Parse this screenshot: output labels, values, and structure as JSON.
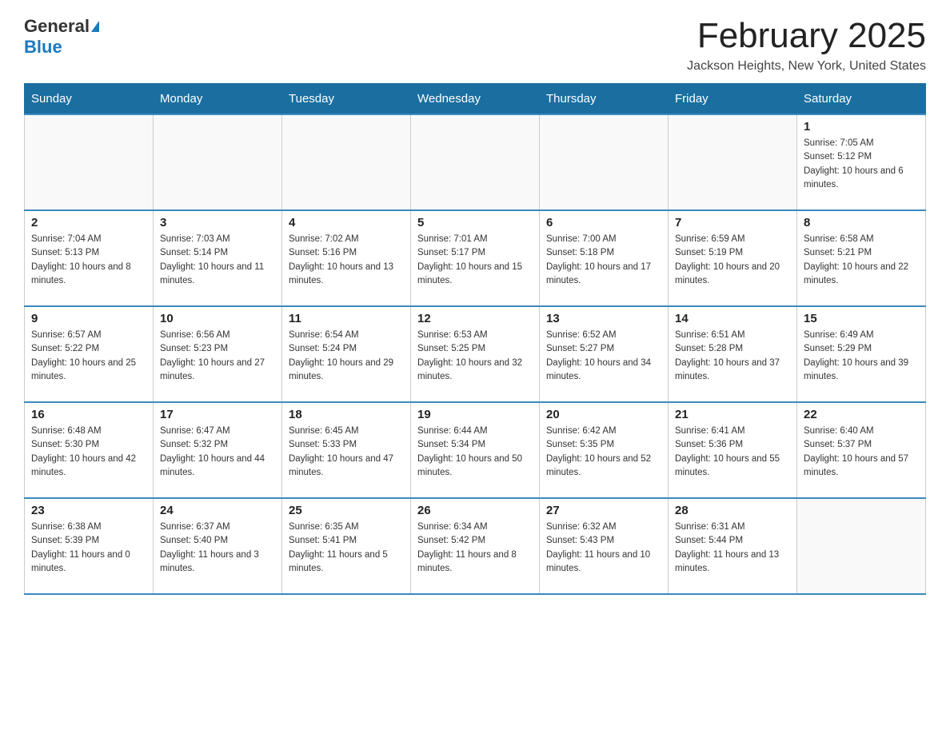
{
  "header": {
    "logo_general": "General",
    "logo_blue": "Blue",
    "month_title": "February 2025",
    "location": "Jackson Heights, New York, United States"
  },
  "days_of_week": [
    "Sunday",
    "Monday",
    "Tuesday",
    "Wednesday",
    "Thursday",
    "Friday",
    "Saturday"
  ],
  "weeks": [
    [
      {
        "day": "",
        "info": ""
      },
      {
        "day": "",
        "info": ""
      },
      {
        "day": "",
        "info": ""
      },
      {
        "day": "",
        "info": ""
      },
      {
        "day": "",
        "info": ""
      },
      {
        "day": "",
        "info": ""
      },
      {
        "day": "1",
        "info": "Sunrise: 7:05 AM\nSunset: 5:12 PM\nDaylight: 10 hours and 6 minutes."
      }
    ],
    [
      {
        "day": "2",
        "info": "Sunrise: 7:04 AM\nSunset: 5:13 PM\nDaylight: 10 hours and 8 minutes."
      },
      {
        "day": "3",
        "info": "Sunrise: 7:03 AM\nSunset: 5:14 PM\nDaylight: 10 hours and 11 minutes."
      },
      {
        "day": "4",
        "info": "Sunrise: 7:02 AM\nSunset: 5:16 PM\nDaylight: 10 hours and 13 minutes."
      },
      {
        "day": "5",
        "info": "Sunrise: 7:01 AM\nSunset: 5:17 PM\nDaylight: 10 hours and 15 minutes."
      },
      {
        "day": "6",
        "info": "Sunrise: 7:00 AM\nSunset: 5:18 PM\nDaylight: 10 hours and 17 minutes."
      },
      {
        "day": "7",
        "info": "Sunrise: 6:59 AM\nSunset: 5:19 PM\nDaylight: 10 hours and 20 minutes."
      },
      {
        "day": "8",
        "info": "Sunrise: 6:58 AM\nSunset: 5:21 PM\nDaylight: 10 hours and 22 minutes."
      }
    ],
    [
      {
        "day": "9",
        "info": "Sunrise: 6:57 AM\nSunset: 5:22 PM\nDaylight: 10 hours and 25 minutes."
      },
      {
        "day": "10",
        "info": "Sunrise: 6:56 AM\nSunset: 5:23 PM\nDaylight: 10 hours and 27 minutes."
      },
      {
        "day": "11",
        "info": "Sunrise: 6:54 AM\nSunset: 5:24 PM\nDaylight: 10 hours and 29 minutes."
      },
      {
        "day": "12",
        "info": "Sunrise: 6:53 AM\nSunset: 5:25 PM\nDaylight: 10 hours and 32 minutes."
      },
      {
        "day": "13",
        "info": "Sunrise: 6:52 AM\nSunset: 5:27 PM\nDaylight: 10 hours and 34 minutes."
      },
      {
        "day": "14",
        "info": "Sunrise: 6:51 AM\nSunset: 5:28 PM\nDaylight: 10 hours and 37 minutes."
      },
      {
        "day": "15",
        "info": "Sunrise: 6:49 AM\nSunset: 5:29 PM\nDaylight: 10 hours and 39 minutes."
      }
    ],
    [
      {
        "day": "16",
        "info": "Sunrise: 6:48 AM\nSunset: 5:30 PM\nDaylight: 10 hours and 42 minutes."
      },
      {
        "day": "17",
        "info": "Sunrise: 6:47 AM\nSunset: 5:32 PM\nDaylight: 10 hours and 44 minutes."
      },
      {
        "day": "18",
        "info": "Sunrise: 6:45 AM\nSunset: 5:33 PM\nDaylight: 10 hours and 47 minutes."
      },
      {
        "day": "19",
        "info": "Sunrise: 6:44 AM\nSunset: 5:34 PM\nDaylight: 10 hours and 50 minutes."
      },
      {
        "day": "20",
        "info": "Sunrise: 6:42 AM\nSunset: 5:35 PM\nDaylight: 10 hours and 52 minutes."
      },
      {
        "day": "21",
        "info": "Sunrise: 6:41 AM\nSunset: 5:36 PM\nDaylight: 10 hours and 55 minutes."
      },
      {
        "day": "22",
        "info": "Sunrise: 6:40 AM\nSunset: 5:37 PM\nDaylight: 10 hours and 57 minutes."
      }
    ],
    [
      {
        "day": "23",
        "info": "Sunrise: 6:38 AM\nSunset: 5:39 PM\nDaylight: 11 hours and 0 minutes."
      },
      {
        "day": "24",
        "info": "Sunrise: 6:37 AM\nSunset: 5:40 PM\nDaylight: 11 hours and 3 minutes."
      },
      {
        "day": "25",
        "info": "Sunrise: 6:35 AM\nSunset: 5:41 PM\nDaylight: 11 hours and 5 minutes."
      },
      {
        "day": "26",
        "info": "Sunrise: 6:34 AM\nSunset: 5:42 PM\nDaylight: 11 hours and 8 minutes."
      },
      {
        "day": "27",
        "info": "Sunrise: 6:32 AM\nSunset: 5:43 PM\nDaylight: 11 hours and 10 minutes."
      },
      {
        "day": "28",
        "info": "Sunrise: 6:31 AM\nSunset: 5:44 PM\nDaylight: 11 hours and 13 minutes."
      },
      {
        "day": "",
        "info": ""
      }
    ]
  ]
}
